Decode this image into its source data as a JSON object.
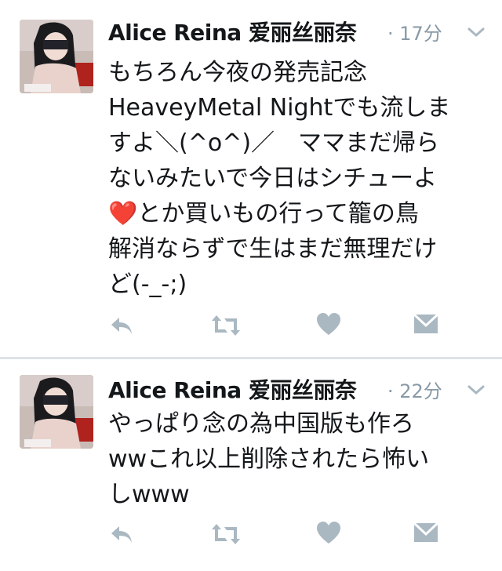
{
  "tweets": [
    {
      "display_name": "Alice Reina 爱丽丝丽奈",
      "timestamp": "· 17分",
      "avatar_caption": "reina 时 3",
      "text": "もちろん今夜の発売記念\nHeaveyMetal Nightでも流しま\nすよ＼(^o^)／　ママまだ帰ら\nないみたいで今日はシチューよ\n❤️とか買いもの行って籠の鳥\n解消ならずで生はまだ無理だけ\nど(-_-;)"
    },
    {
      "display_name": "Alice Reina 爱丽丝丽奈",
      "timestamp": "· 22分",
      "avatar_caption": "reina 时 3",
      "text": "やっぱり念の為中国版も作ろ\nwwこれ以上削除されたら怖い\nしwww"
    }
  ],
  "icons": {
    "reply": "reply-icon",
    "retweet": "retweet-icon",
    "like": "heart-icon",
    "dm": "direct-message-icon",
    "more": "chevron-down-icon"
  },
  "colors": {
    "text": "#14171a",
    "muted": "#8899a6",
    "icon": "#aab8c2",
    "divider": "#dde2e6"
  }
}
